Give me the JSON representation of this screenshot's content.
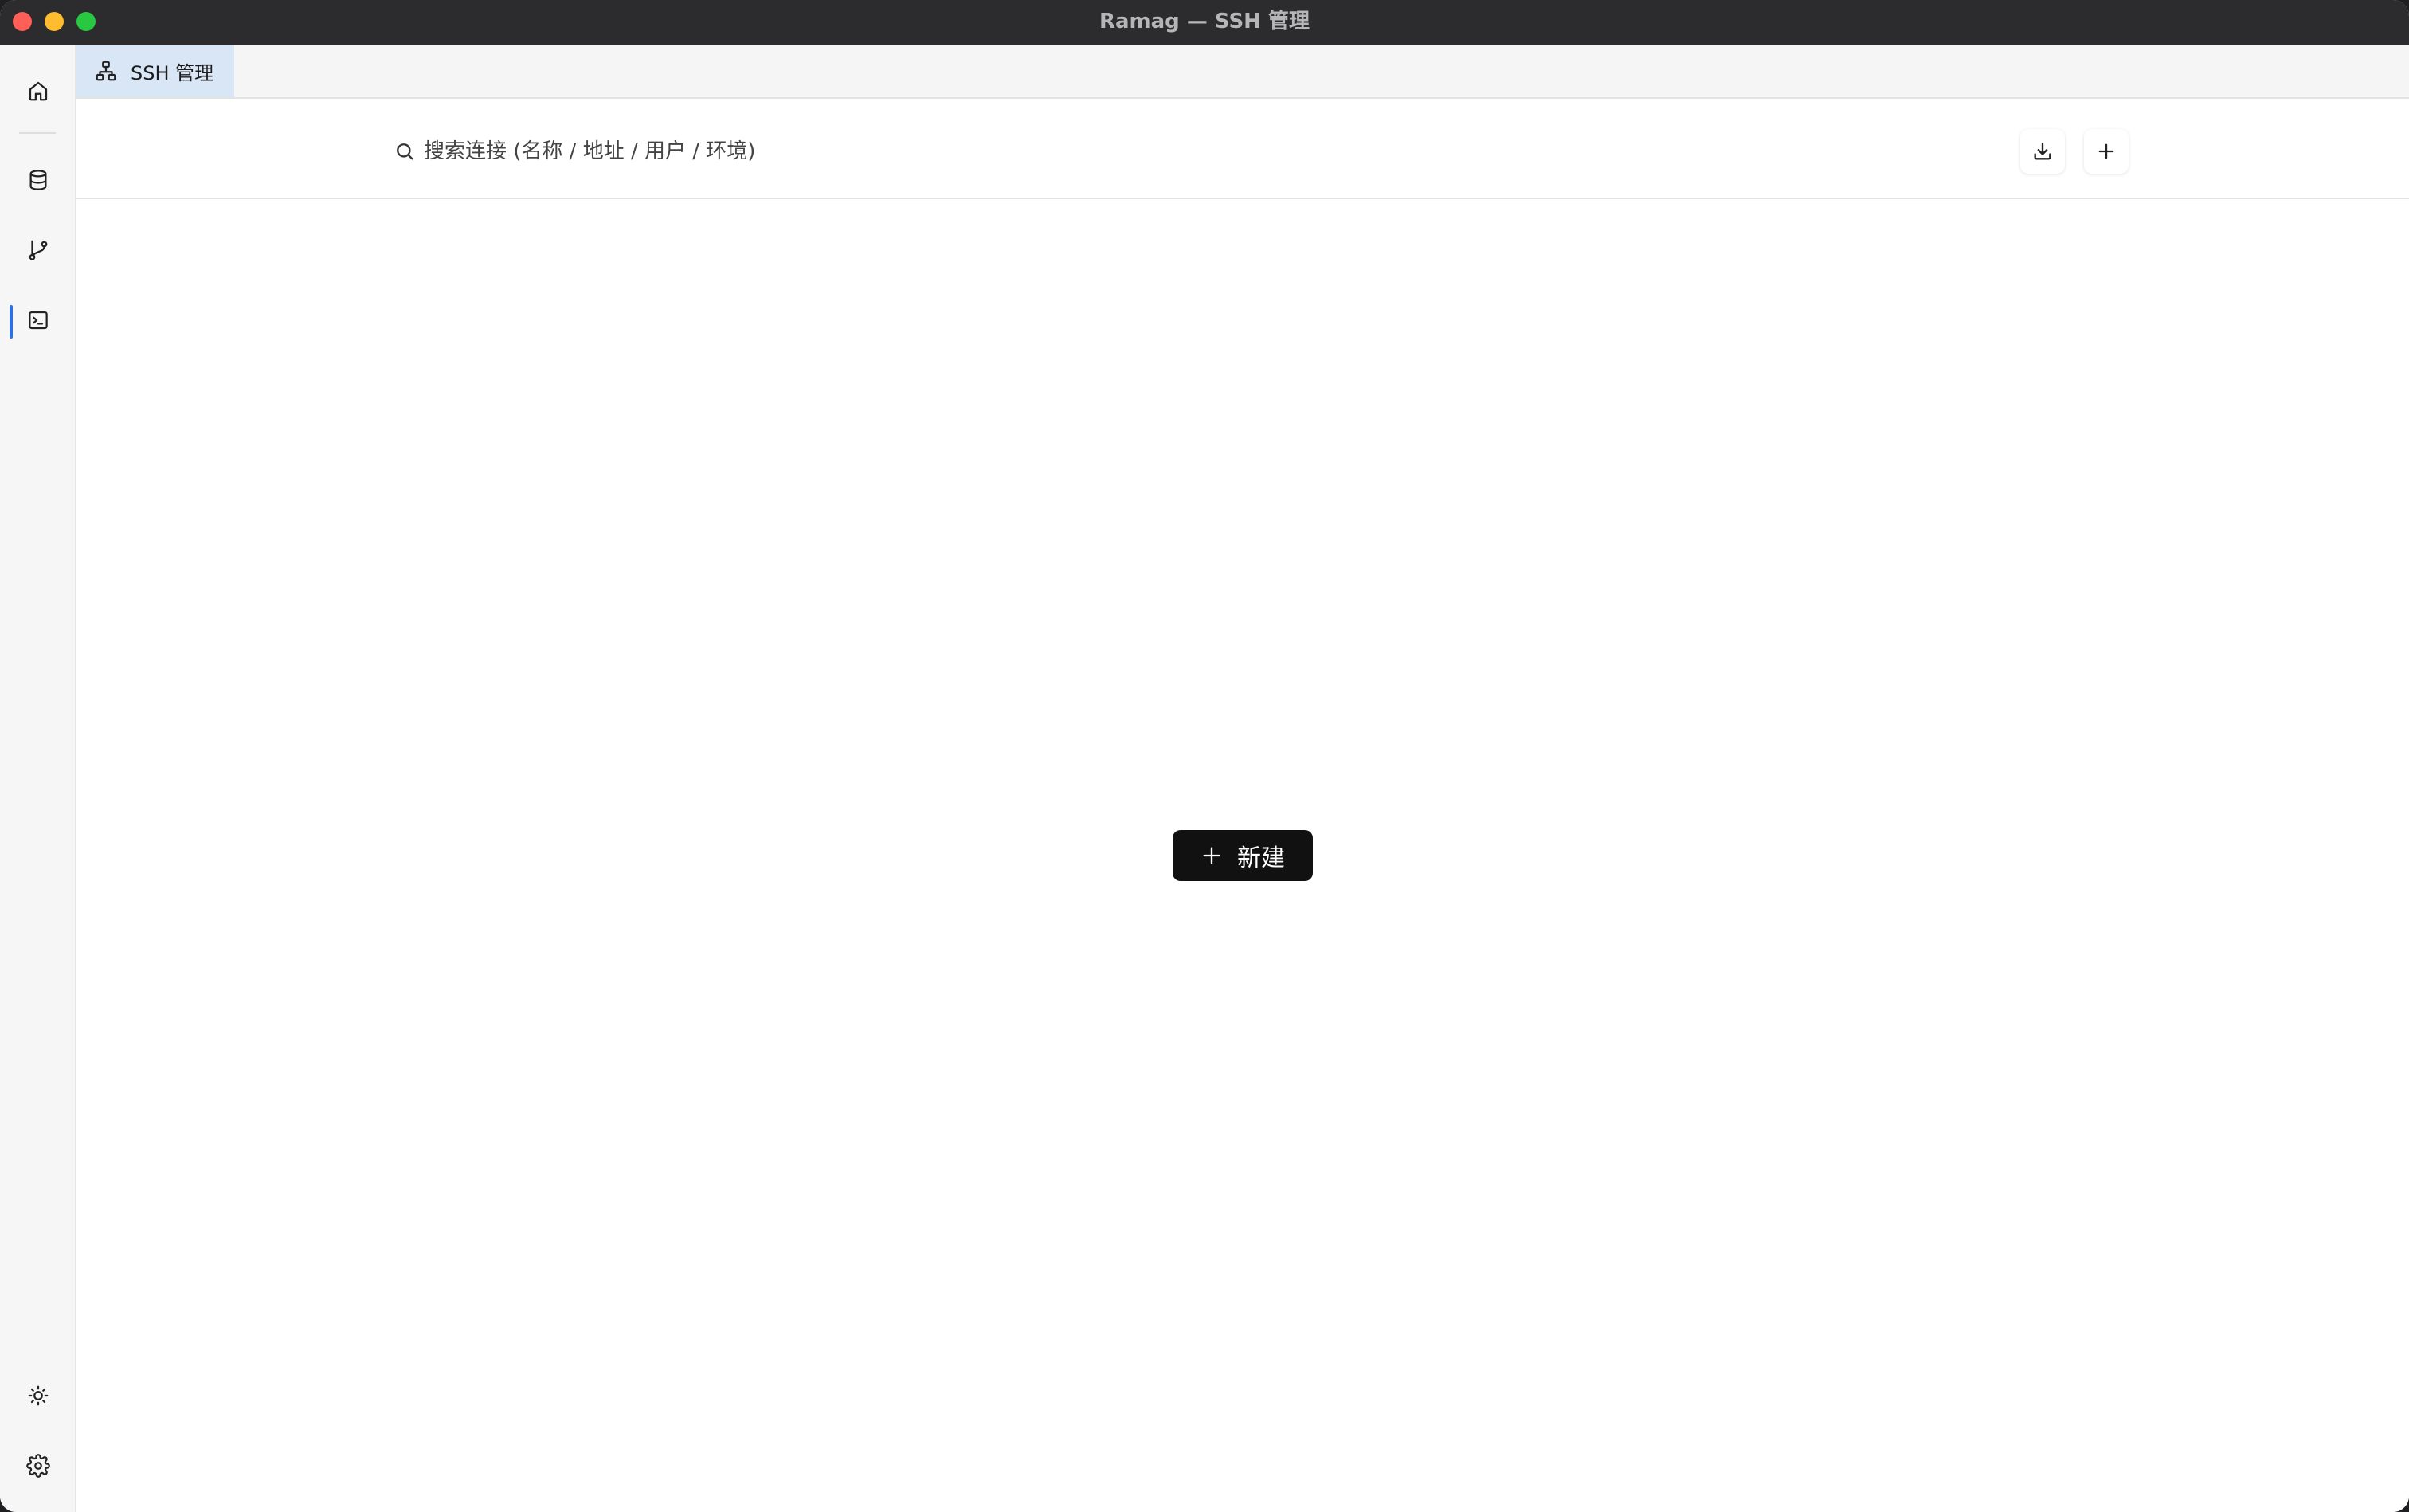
{
  "window": {
    "title": "Ramag — SSH 管理"
  },
  "rail": {
    "items": [
      {
        "name": "home",
        "icon": "home-icon"
      },
      {
        "name": "database",
        "icon": "database-icon"
      },
      {
        "name": "git",
        "icon": "git-branch-icon"
      },
      {
        "name": "terminal",
        "icon": "terminal-icon",
        "active": true
      }
    ],
    "bottom": [
      {
        "name": "theme",
        "icon": "sun-icon"
      },
      {
        "name": "settings",
        "icon": "gear-icon"
      }
    ]
  },
  "tabs": [
    {
      "label": "SSH 管理",
      "icon": "network-icon",
      "active": true
    }
  ],
  "toolbar": {
    "search_placeholder": "搜索连接 (名称 / 地址 / 用户 / 环境)",
    "search_value": "",
    "import_icon": "download-icon",
    "add_icon": "plus-icon"
  },
  "empty_state": {
    "new_button_label": "新建"
  },
  "colors": {
    "accent": "#2f6fe0",
    "tab_active_bg": "#d9e6f5",
    "primary_button_bg": "#111111"
  }
}
